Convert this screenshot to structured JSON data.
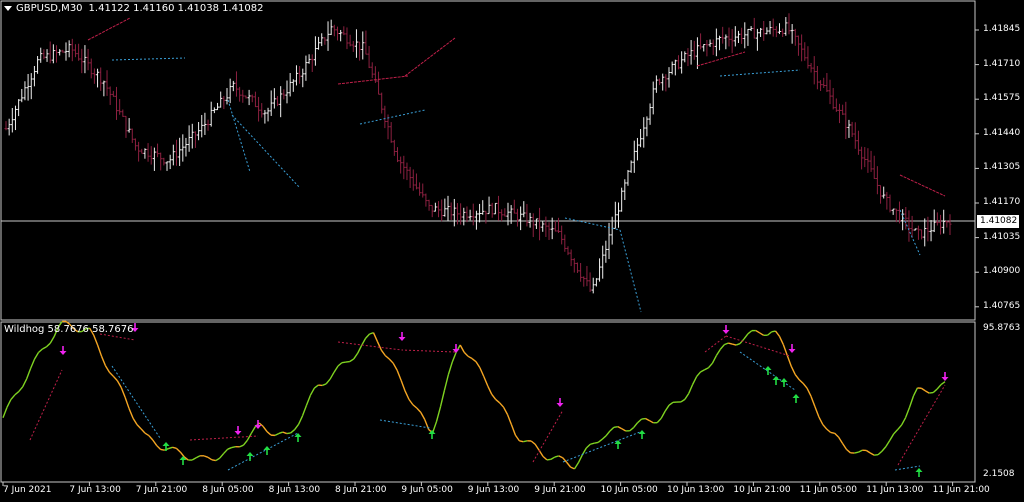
{
  "main_chart": {
    "symbol_timeframe": "GBPUSD,M30",
    "ohlc": "1.41122 1.41160 1.41038 1.41082",
    "price_ticks": [
      "1.41845",
      "1.41710",
      "1.41575",
      "1.41440",
      "1.41305",
      "1.41170",
      "1.41035",
      "1.40900",
      "1.40765"
    ],
    "current_price": "1.41082"
  },
  "indicator": {
    "name_values": "Wildhog 58.7676 58.7676",
    "scale_max": "95.8763",
    "scale_min": "2.1508"
  },
  "time_axis": [
    "7 Jun 2021",
    "7 Jun 13:00",
    "7 Jun 21:00",
    "8 Jun 05:00",
    "8 Jun 13:00",
    "8 Jun 21:00",
    "9 Jun 05:00",
    "9 Jun 13:00",
    "9 Jun 21:00",
    "10 Jun 05:00",
    "10 Jun 13:00",
    "10 Jun 21:00",
    "11 Jun 05:00",
    "11 Jun 13:00",
    "11 Jun 21:00"
  ],
  "colors": {
    "background": "#000000",
    "up_bar": "#f0f0f0",
    "down_bar": "#8c2040",
    "rising_osc": "#7fd321",
    "falling_osc": "#f5a623",
    "bullish_div": "#3aa0d8",
    "bearish_div": "#c0204a",
    "up_arrow": "#22dd44",
    "down_arrow": "#ee22ee",
    "grid": "#c8c8c8"
  },
  "chart_data": [
    {
      "type": "ohlc",
      "series": [
        {
          "name": "GBPUSD,M30",
          "close": [
            1.4142,
            1.4168,
            1.4172,
            1.416,
            1.4135,
            1.413,
            1.4142,
            1.4158,
            1.4148,
            1.4162,
            1.418,
            1.4172,
            1.4132,
            1.4112,
            1.411,
            1.4112,
            1.4108,
            1.4102,
            1.408,
            1.412,
            1.416,
            1.417,
            1.4176,
            1.4178,
            1.418,
            1.416,
            1.414,
            1.4115,
            1.4102,
            1.4108
          ]
        }
      ],
      "ylim": [
        1.407,
        1.419
      ],
      "grid": "current price line"
    },
    {
      "type": "line",
      "series": [
        {
          "name": "Wildhog",
          "values": [
            40,
            70,
            95,
            92,
            60,
            28,
            20,
            15,
            20,
            35,
            28,
            58,
            72,
            90,
            60,
            30,
            85,
            60,
            30,
            18,
            12,
            30,
            35,
            40,
            55,
            78,
            88,
            92,
            60,
            30,
            18,
            22,
            55,
            58.77
          ]
        }
      ],
      "ylim": [
        2.1508,
        95.8763
      ]
    }
  ]
}
